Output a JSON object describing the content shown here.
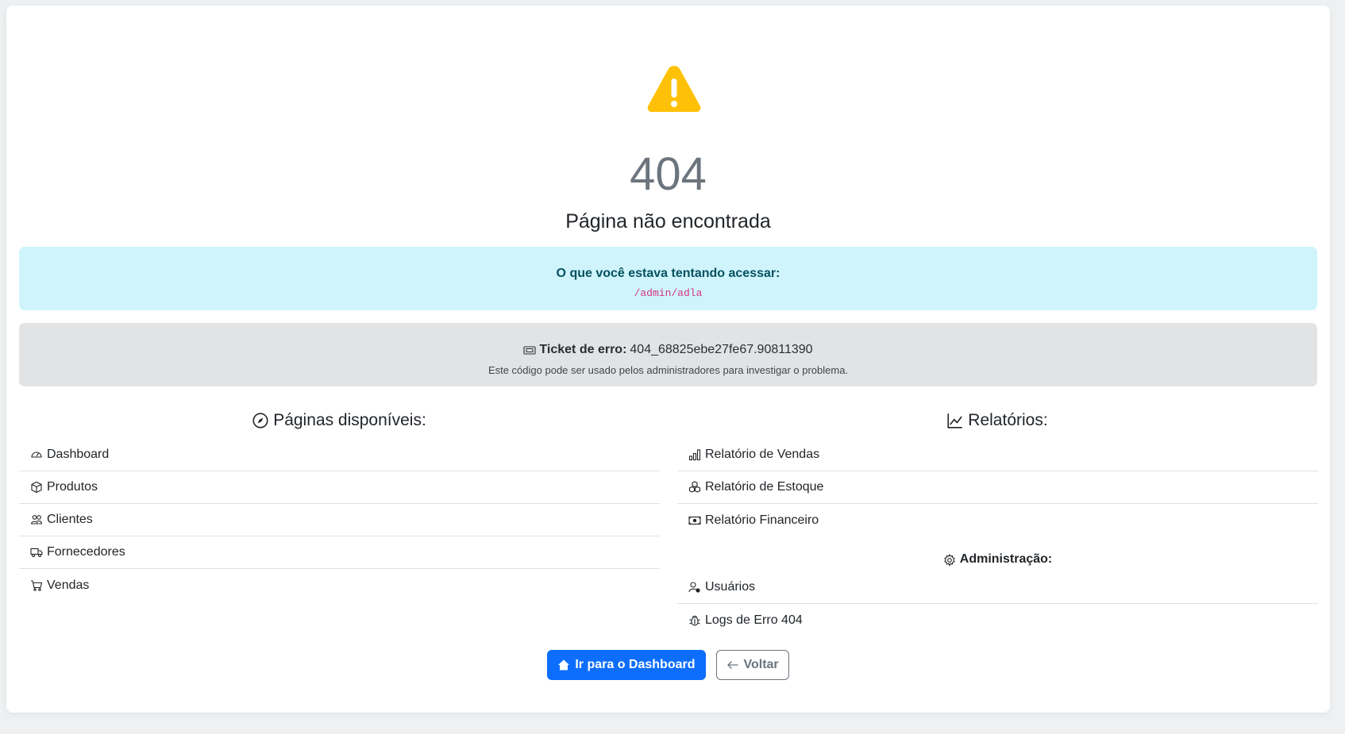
{
  "error": {
    "code": "404",
    "title": "Página não encontrada"
  },
  "attempt": {
    "label": "O que você estava tentando acessar:",
    "path": "/admin/adla"
  },
  "ticket": {
    "label": "Ticket de erro:",
    "value": "404_68825ebe27fe67.90811390",
    "note": "Este código pode ser usado pelos administradores para investigar o problema."
  },
  "pages": {
    "heading": "Páginas disponíveis:",
    "items": [
      {
        "label": "Dashboard",
        "icon": "speedometer-icon"
      },
      {
        "label": "Produtos",
        "icon": "box-icon"
      },
      {
        "label": "Clientes",
        "icon": "people-icon"
      },
      {
        "label": "Fornecedores",
        "icon": "truck-icon"
      },
      {
        "label": "Vendas",
        "icon": "cart-icon"
      }
    ]
  },
  "reports": {
    "heading": "Relatórios:",
    "items": [
      {
        "label": "Relatório de Vendas",
        "icon": "bar-chart-icon"
      },
      {
        "label": "Relatório de Estoque",
        "icon": "boxes-icon"
      },
      {
        "label": "Relatório Financeiro",
        "icon": "cash-icon"
      }
    ]
  },
  "admin": {
    "heading": "Administração:",
    "items": [
      {
        "label": "Usuários",
        "icon": "person-gear-icon"
      },
      {
        "label": "Logs de Erro 404",
        "icon": "bug-icon"
      }
    ]
  },
  "buttons": {
    "dashboard": "Ir para o Dashboard",
    "back": "Voltar"
  },
  "colors": {
    "warning": "#ffc107",
    "primary": "#0d6efd",
    "info_bg": "#cff4fc",
    "secondary_bg": "#e2e3e5"
  }
}
